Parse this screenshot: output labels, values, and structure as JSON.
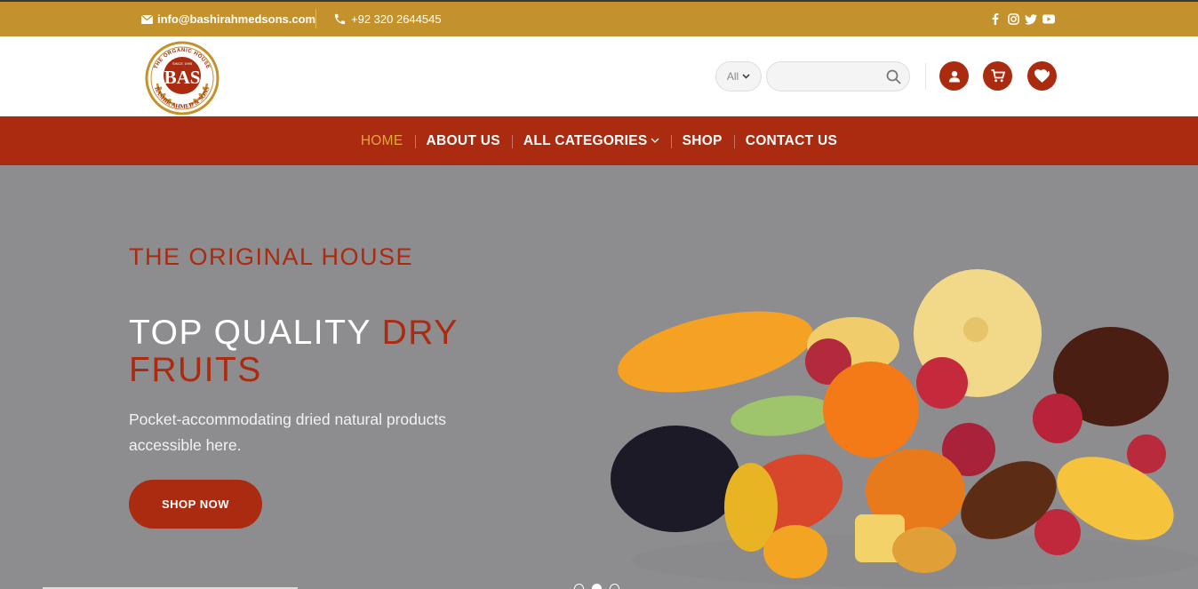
{
  "topbar": {
    "email": "info@bashirahmedsons.com",
    "phone": "+92 320 2644545",
    "social_icons": [
      "facebook-icon",
      "instagram-icon",
      "twitter-icon",
      "youtube-icon"
    ]
  },
  "header": {
    "logo": {
      "top_text": "THE ORGANIC HOUSE",
      "since": "SINCE 1995",
      "initials": "BAS",
      "bottom_text": "BASHIR AHMED & SONS"
    },
    "search": {
      "category": "All",
      "placeholder": ""
    },
    "icons": [
      "account-icon",
      "cart-icon",
      "heart-icon"
    ]
  },
  "nav": {
    "items": [
      {
        "label": "HOME",
        "active": true
      },
      {
        "label": "ABOUT US",
        "active": false
      },
      {
        "label": "ALL CATEGORIES",
        "active": false,
        "has_dropdown": true
      },
      {
        "label": "SHOP",
        "active": false
      },
      {
        "label": "CONTACT US",
        "active": false
      }
    ]
  },
  "hero": {
    "kicker": "THE ORIGINAL HOUSE",
    "headline_part1": "TOP QUALITY ",
    "headline_part2": "DRY FRUITS",
    "tagline": "Pocket-accommodating dried natural products accessible here.",
    "cta_label": "SHOP NOW",
    "slide_count": 3,
    "active_slide": 2
  },
  "colors": {
    "topbar": "#c4922c",
    "brand_red": "#ab2b10",
    "nav_active": "#e2a937",
    "hero_bg": "#8d8c8e"
  }
}
